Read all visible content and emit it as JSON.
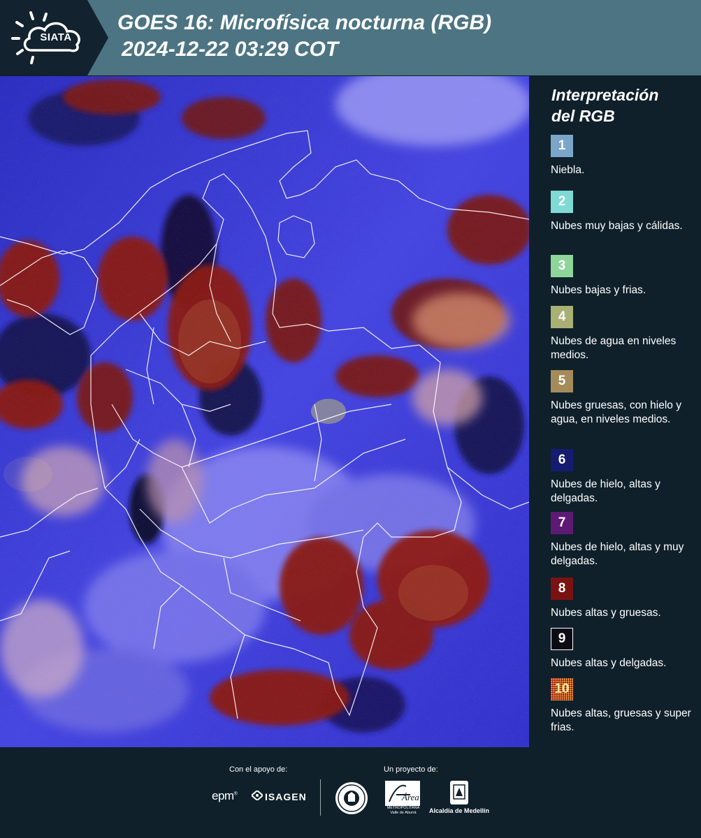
{
  "header": {
    "logo_text": "SIATA",
    "title_line1": "GOES 16: Microfísica nocturna (RGB)",
    "title_line2": "2024-12-22 03:29 COT",
    "background": "#4c7483",
    "logo_panel_color": "#12222e"
  },
  "legend": {
    "title_line1": "Interpretación",
    "title_line2": "del RGB",
    "items": [
      {
        "number": "1",
        "label": "Niebla.",
        "color": "#7aa6c9",
        "text_color": "#ffffff"
      },
      {
        "number": "2",
        "label": "Nubes muy bajas y cálidas.",
        "color": "#7fdad6",
        "text_color": "#ffffff"
      },
      {
        "number": "3",
        "label": "Nubes bajas y frias.",
        "color": "#8ed59a",
        "text_color": "#ffffff"
      },
      {
        "number": "4",
        "label": "Nubes de agua en niveles medios.",
        "color": "#a9b073",
        "text_color": "#ffffff"
      },
      {
        "number": "5",
        "label": "Nubes gruesas, con hielo y agua, en niveles medios.",
        "color": "#a58b5a",
        "text_color": "#ffffff"
      },
      {
        "number": "6",
        "label": "Nubes de hielo, altas y delgadas.",
        "color": "#161b72",
        "text_color": "#ffffff"
      },
      {
        "number": "7",
        "label": "Nubes de hielo, altas y muy delgadas.",
        "color": "#5d1a74",
        "text_color": "#ffffff"
      },
      {
        "number": "8",
        "label": "Nubes altas y gruesas.",
        "color": "#7a1212",
        "text_color": "#ffffff"
      },
      {
        "number": "9",
        "label": "Nubes altas y delgadas.",
        "color": "#0b0b14",
        "text_color": "#ffffff"
      },
      {
        "number": "10",
        "label": "Nubes altas, gruesas y super frias.",
        "color": "#9e1a10",
        "text_color": "#ffe9a0"
      }
    ]
  },
  "map": {
    "base_color": "#3a3ad8",
    "cloud_colors": [
      "#8a1a14",
      "#5e2020",
      "#d89070",
      "#c8a8c8",
      "#1d1d70",
      "#2a0f3a"
    ]
  },
  "footer": {
    "support_caption": "Con el apoyo de:",
    "project_caption": "Un proyecto de:",
    "epm_text": "epm",
    "epm_mark": "®",
    "isagen_text": "ISAGEN",
    "area_caption_line1": "METROPOLITANA",
    "area_caption_line2": "Valle de Aburrá",
    "area_wordmark": "Área",
    "alcaldia_text": "Alcaldía de Medellín"
  }
}
